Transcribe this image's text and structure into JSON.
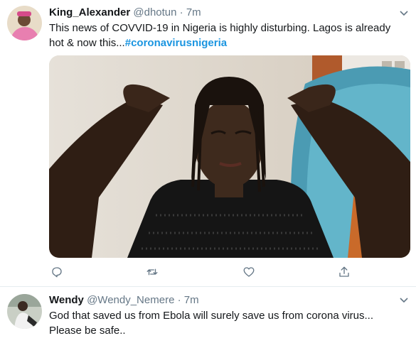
{
  "tweets": [
    {
      "name": "King_Alexander",
      "handle": "@dhotun",
      "separator": "·",
      "time": "7m",
      "text": "This news of COVVID-19 in Nigeria is highly disturbing. Lagos is already hot & now this...",
      "hashtag": "#coronavirusnigeria"
    },
    {
      "name": "Wendy",
      "handle": "@Wendy_Nemere",
      "separator": "·",
      "time": "7m",
      "text_line1": "God that saved us from Ebola will surely save us from corona virus...",
      "text_line2": "Please be safe.."
    }
  ],
  "icons": {
    "reply": "reply-icon",
    "retweet": "retweet-icon",
    "like": "like-icon",
    "share": "share-icon",
    "caret": "chevron-down-icon"
  },
  "colors": {
    "text": "#14171a",
    "secondary": "#657786",
    "link": "#1b95e0",
    "divider": "#e6ecf0"
  }
}
